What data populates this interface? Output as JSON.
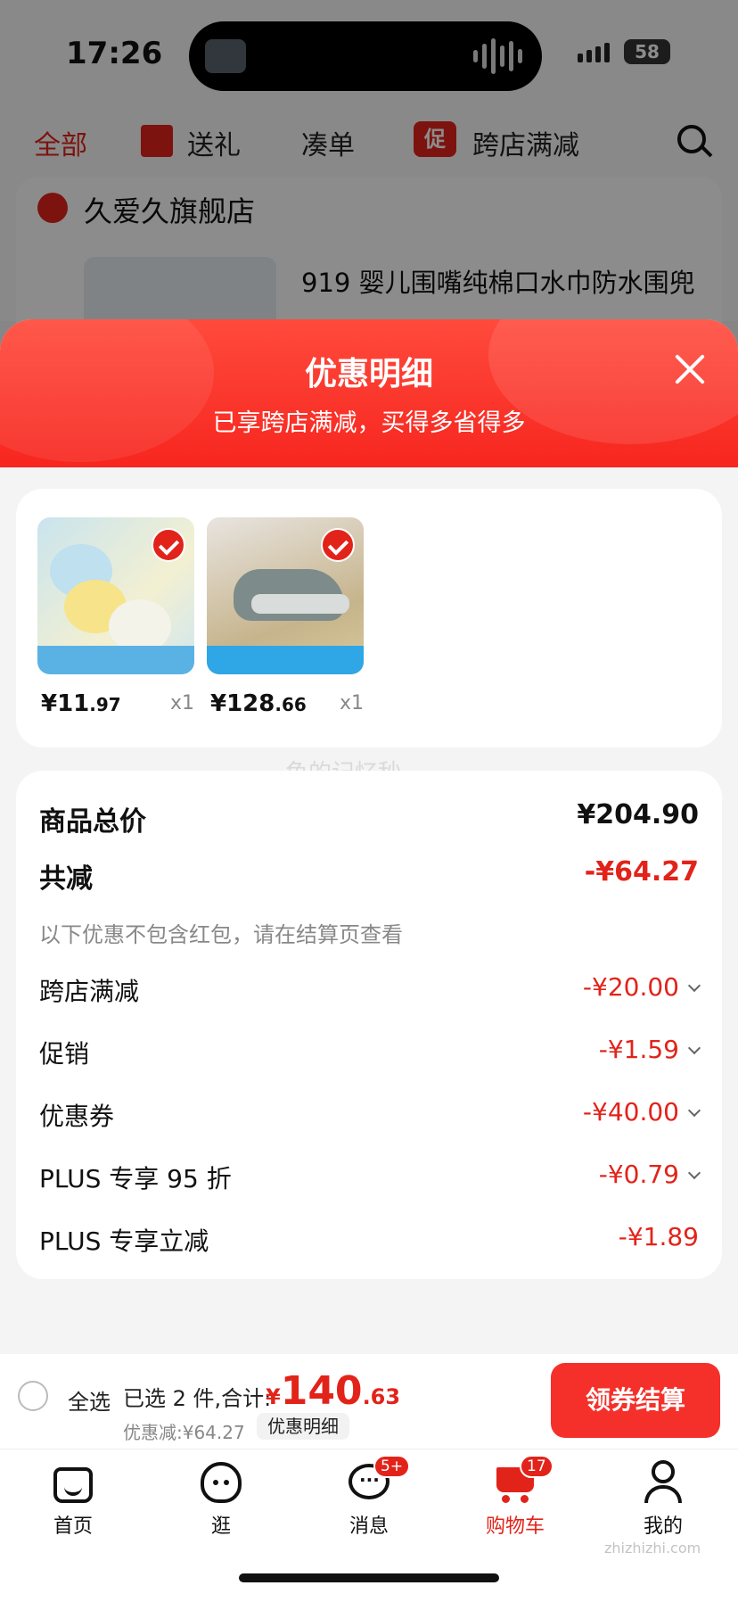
{
  "status": {
    "time": "17:26",
    "battery": "58"
  },
  "categories": {
    "all": "全部",
    "gift": "送礼",
    "bundle": "凑单",
    "promo_badge": "促",
    "cross_store": "跨店满减"
  },
  "store": {
    "name": "久爱久旗舰店",
    "product_title": "919 婴儿围嘴纯棉口水巾防水围兜"
  },
  "sheet": {
    "title": "优惠明细",
    "subtitle": "已享跨店满减，买得多省得多"
  },
  "products": [
    {
      "price_int": "¥11",
      "price_dec": ".97",
      "qty": "x1",
      "icon": "bib-product-image"
    },
    {
      "price_int": "¥128",
      "price_dec": ".66",
      "qty": "x1",
      "icon": "sneaker-product-image"
    }
  ],
  "summary": {
    "total_label": "商品总价",
    "total_value": "¥204.90",
    "reduce_label": "共减",
    "reduce_value": "-¥64.27",
    "note": "以下优惠不包含红包，请在结算页查看",
    "items": [
      {
        "label": "跨店满减",
        "value": "-¥20.00"
      },
      {
        "label": "促销",
        "value": "-¥1.59"
      },
      {
        "label": "优惠券",
        "value": "-¥40.00"
      },
      {
        "label": "PLUS 专享 95 折",
        "value": "-¥0.79"
      },
      {
        "label": "PLUS 专享立减",
        "value": "-¥1.89"
      }
    ]
  },
  "watermark": "鱼的记忆秒",
  "checkout": {
    "select_all": "全选",
    "selected_text": "已选 2 件,合计:",
    "yen": "¥",
    "amount_int": "140",
    "amount_dec": ".63",
    "discount_note": "优惠减:¥64.27",
    "detail_chip": "优惠明细",
    "button": "领券结算"
  },
  "tabs": [
    {
      "label": "首页",
      "icon": "home-icon"
    },
    {
      "label": "逛",
      "icon": "browse-icon"
    },
    {
      "label": "消息",
      "icon": "message-icon",
      "badge": "5+"
    },
    {
      "label": "购物车",
      "icon": "cart-icon",
      "badge": "17"
    },
    {
      "label": "我的",
      "icon": "profile-icon"
    }
  ],
  "site_mark": "zhizhizhi.com",
  "colors": {
    "accent": "#e2231a",
    "header_gradient_top": "#ff4a3c",
    "button": "#f5302a"
  }
}
